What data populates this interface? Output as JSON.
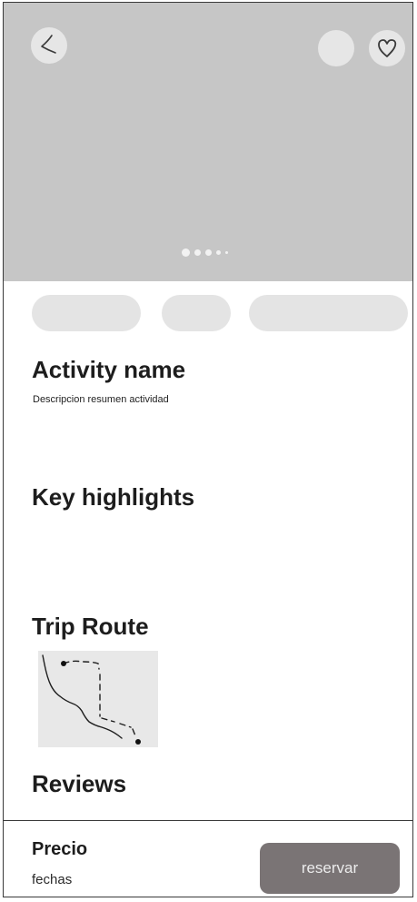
{
  "hero": {
    "carousel": {
      "page_count": 5,
      "active_index": 0
    }
  },
  "chips_count": 3,
  "activity": {
    "name": "Activity name",
    "description": "Descripcion resumen actividad"
  },
  "sections": {
    "key_highlights": "Key highlights",
    "trip_route": "Trip Route",
    "reviews": "Reviews"
  },
  "footer": {
    "price_label": "Precio",
    "dates_label": "fechas",
    "reserve_label": "reservar"
  },
  "icons": {
    "back": "back-arrow-icon",
    "favorite": "heart-icon",
    "map": "route-map-icon"
  },
  "colors": {
    "hero_background": "#c6c6c6",
    "chip_background": "#e4e4e4",
    "button_background": "#7a7475",
    "button_text": "#ececec"
  }
}
